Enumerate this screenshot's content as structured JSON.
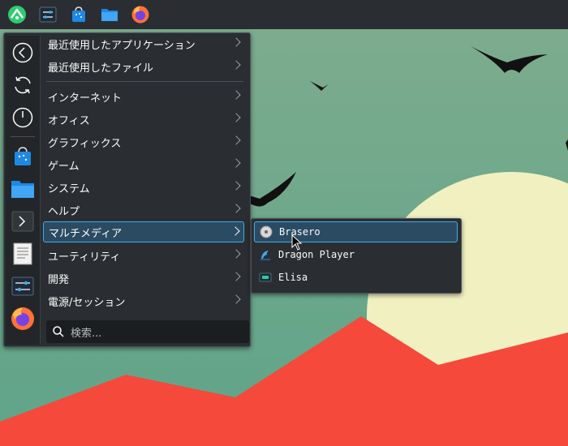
{
  "top_panel": {
    "items": [
      "app-launcher-icon",
      "system-settings-icon",
      "discover-store-icon",
      "file-manager-icon",
      "firefox-icon"
    ]
  },
  "menu": {
    "sidebar": [
      "back-icon",
      "refresh-icon",
      "power-icon",
      "discover-store-icon",
      "folder-icon",
      "terminal-icon",
      "text-editor-icon",
      "system-settings-icon",
      "firefox-icon"
    ],
    "categories": [
      {
        "label": "最近使用したアプリケーション"
      },
      {
        "label": "最近使用したファイル"
      },
      {
        "label": "インターネット"
      },
      {
        "label": "オフィス"
      },
      {
        "label": "グラフィックス"
      },
      {
        "label": "ゲーム"
      },
      {
        "label": "システム"
      },
      {
        "label": "ヘルプ"
      },
      {
        "label": "マルチメディア"
      },
      {
        "label": "ユーティリティ"
      },
      {
        "label": "開発"
      },
      {
        "label": "電源/セッション"
      }
    ],
    "active_category": "マルチメディア",
    "search_placeholder": "検索..."
  },
  "submenu": {
    "items": [
      {
        "label": "Brasero",
        "icon": "disc-icon"
      },
      {
        "label": "Dragon Player",
        "icon": "dragon-player-icon"
      },
      {
        "label": "Elisa",
        "icon": "elisa-icon"
      }
    ],
    "active_item": "Brasero"
  },
  "colors": {
    "panel_bg": "#2a2e32",
    "accent": "#3daee9",
    "wallpaper_green": "#6fa98a",
    "wallpaper_red": "#f0493a",
    "sun": "#f0f0c0"
  }
}
